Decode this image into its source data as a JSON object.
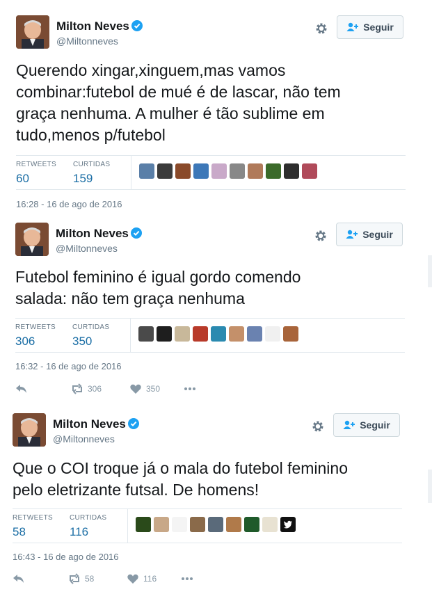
{
  "follow_label": "Seguir",
  "stat_labels": {
    "retweets": "RETWEETS",
    "likes": "CURTIDAS"
  },
  "tweets": [
    {
      "author": "Milton Neves",
      "handle": "@Miltonneves",
      "text_lines": [
        "Querendo xingar,xinguem,mas vamos",
        "combinar:futebol de mué é de lascar, não tem",
        "graça nenhuma. A mulher é tão sublime em",
        "tudo,menos p/futebol"
      ],
      "retweets": "60",
      "likes": "159",
      "timestamp": "16:28 - 16 de ago de 2016"
    },
    {
      "author": "Milton Neves",
      "handle": "@Miltonneves",
      "text_lines": [
        "Futebol feminino é igual gordo comendo",
        "salada: não tem graça nenhuma"
      ],
      "retweets": "306",
      "likes": "350",
      "timestamp": "16:32 - 16 de ago de 2016",
      "action_retweets": "306",
      "action_likes": "350"
    },
    {
      "author": "Milton Neves",
      "handle": "@Miltonneves",
      "text_lines": [
        "Que o COI troque já o mala do futebol feminino",
        "pelo eletrizante futsal. De homens!"
      ],
      "retweets": "58",
      "likes": "116",
      "timestamp": "16:43 - 16 de ago de 2016",
      "action_retweets": "58",
      "action_likes": "116"
    }
  ],
  "colors": {
    "link_blue": "#1b6ea5",
    "verified": "#1da1f2",
    "muted": "#657786"
  },
  "icons": [
    "verified-badge-icon",
    "gear-icon",
    "follow-person-icon",
    "reply-icon",
    "retweet-icon",
    "heart-icon",
    "more-icon"
  ]
}
